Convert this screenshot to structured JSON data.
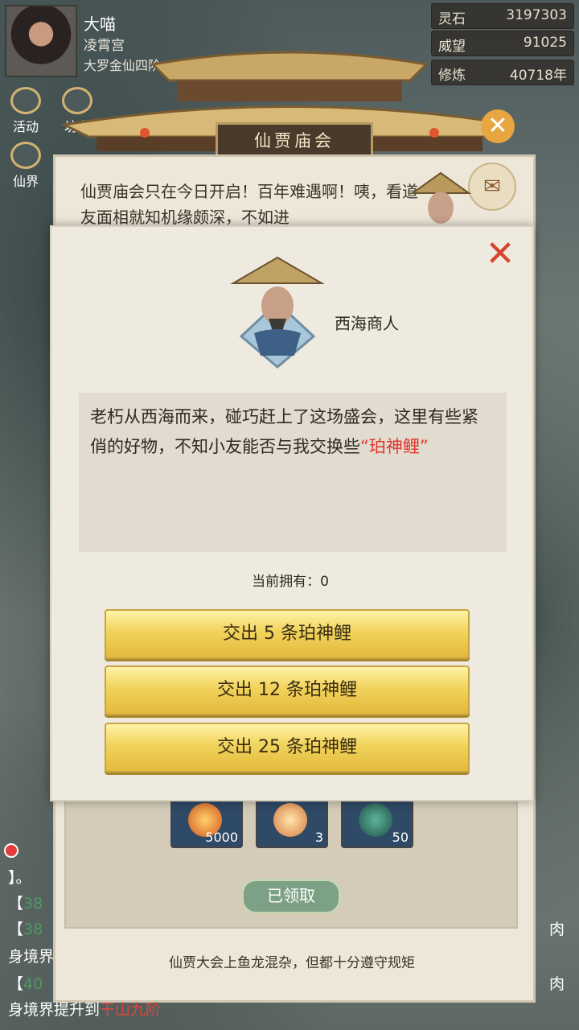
{
  "player": {
    "name": "大喵",
    "sect": "凌霄宫",
    "realm": "大罗金仙四阶"
  },
  "stats": [
    {
      "label": "灵石",
      "value": "3197303"
    },
    {
      "label": "威望",
      "value": "91025"
    },
    {
      "label": "修炼",
      "value": "40718年"
    }
  ],
  "quick_nav": {
    "activities": "活动",
    "market": "坊市",
    "immortal_realm": "仙界"
  },
  "event": {
    "title": "仙贾庙会",
    "intro": "仙贾庙会只在今日开启！百年难遇啊！咦，看道友面相就知机缘颇深，不如进",
    "rewards": [
      {
        "icon": "orange-crystal-icon",
        "count": "5000"
      },
      {
        "icon": "fire-orb-icon",
        "count": "3"
      },
      {
        "icon": "jade-token-icon",
        "count": "50"
      }
    ],
    "claimed_label": "已领取",
    "footer_tip": "仙贾大会上鱼龙混杂，但都十分遵守规矩"
  },
  "modal": {
    "npc_name": "西海商人",
    "dialog_main": "老朽从西海而来，碰巧赶上了这场盛会，这里有些紧俏的好物，不知小友能否与我交换些",
    "dialog_highlight": "“珀神鲤”",
    "owned_label": "当前拥有：0",
    "buttons": [
      {
        "label": "交出 5 条珀神鲤"
      },
      {
        "label": "交出 12 条珀神鲤"
      },
      {
        "label": "交出 25 条珀神鲤"
      }
    ]
  },
  "chat": [
    {
      "prefix": "】",
      "green": "",
      "text": "。",
      "right": ""
    },
    {
      "prefix": "【",
      "green": "38",
      "text": "",
      "right": ""
    },
    {
      "prefix": "【",
      "green": "38",
      "text": "",
      "right": "肉"
    },
    {
      "prefix": "",
      "green": "",
      "text": "身境界",
      "right": ""
    },
    {
      "prefix": "【",
      "green": "40",
      "text": "",
      "right": "肉"
    },
    {
      "prefix": "",
      "green": "",
      "text": "身境界提升到",
      "red": "干山九阶",
      "right": ""
    }
  ],
  "colors": {
    "accent_gold": "#f1d35c",
    "highlight_red": "#e2342a",
    "close_red": "#d6452d",
    "claimed_green": "#7ca185"
  }
}
